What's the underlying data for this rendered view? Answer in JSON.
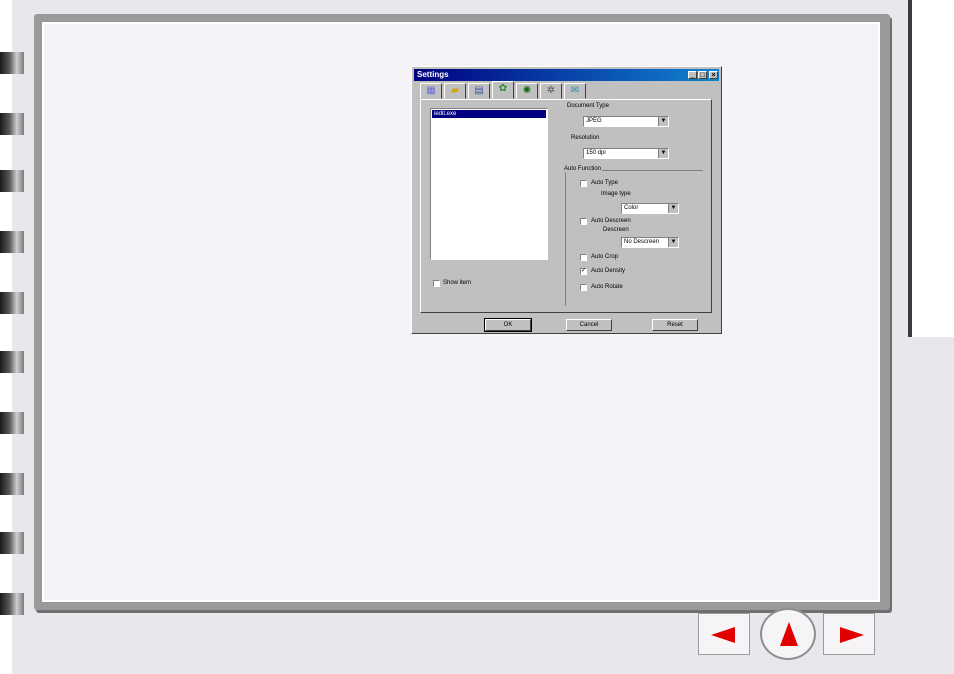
{
  "dialog": {
    "title": "Settings",
    "controls": {
      "minimize": "_",
      "maximize": "□",
      "close": "×"
    },
    "tabs": [
      {
        "icon": "scanner-icon"
      },
      {
        "icon": "folder-icon"
      },
      {
        "icon": "document-icon"
      },
      {
        "icon": "color-icon",
        "active": true
      },
      {
        "icon": "gear-icon"
      },
      {
        "icon": "gears-icon"
      },
      {
        "icon": "envelope-icon"
      }
    ],
    "app_list": {
      "selected_item": "iedit.exe"
    },
    "show_item_label": "Show item",
    "document_type": {
      "label": "Document Type",
      "value": "JPEG"
    },
    "resolution": {
      "label": "Resolution",
      "value": "150 dpi"
    },
    "auto_function": {
      "label": "Auto Function",
      "auto_type": {
        "label": "Auto Type",
        "checked": false
      },
      "image_type": {
        "label": "Image type",
        "value": "Color"
      },
      "auto_descreen": {
        "label": "Auto Descreen",
        "checked": false
      },
      "descreen": {
        "label": "Descreen",
        "value": "No Descreen"
      },
      "auto_crop": {
        "label": "Auto Crop",
        "checked": false
      },
      "auto_density": {
        "label": "Auto Density",
        "checked": true
      },
      "auto_rotate": {
        "label": "Auto Rotate",
        "checked": false
      }
    },
    "buttons": {
      "ok": "OK",
      "cancel": "Cancel",
      "reset": "Reset"
    }
  },
  "navigation": {
    "prev": "left-arrow-icon",
    "up": "up-arrow-icon",
    "next": "right-arrow-icon"
  },
  "colors": {
    "titlebar": "#000080",
    "nav_arrow": "#e00000",
    "dialog": "#c0c0c0"
  }
}
